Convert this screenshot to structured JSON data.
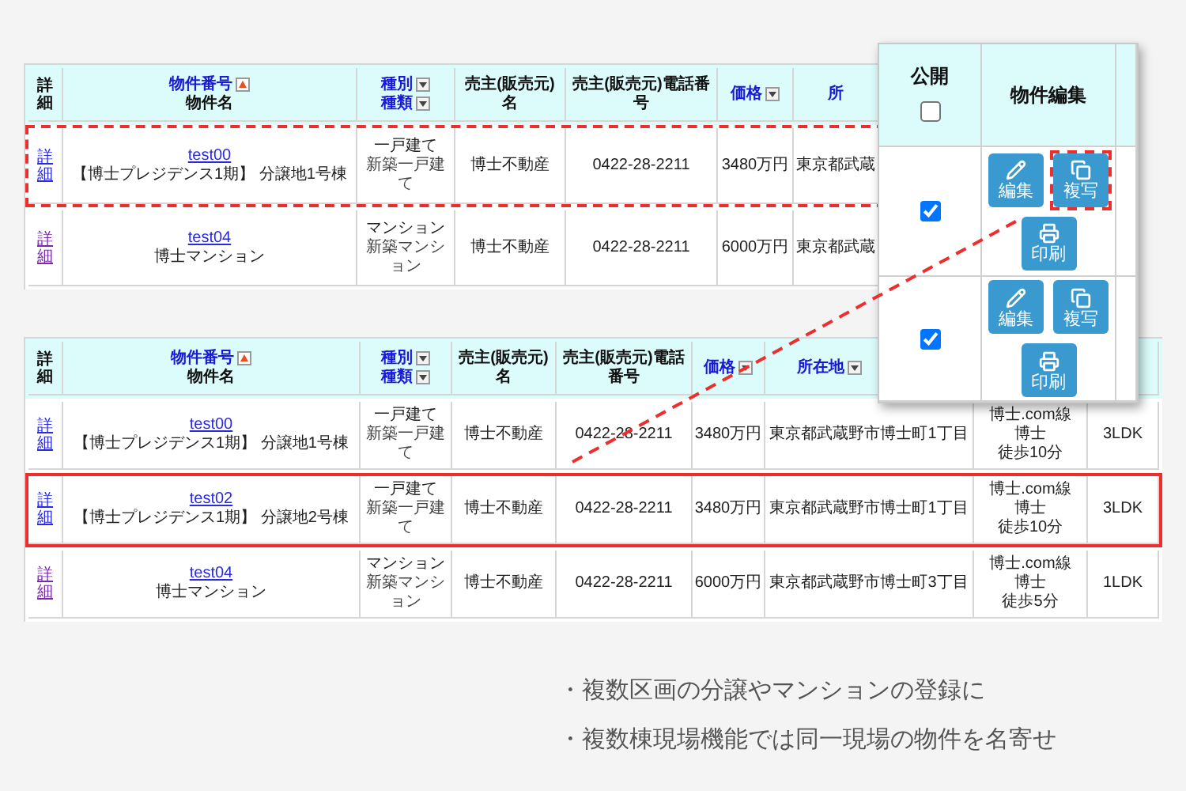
{
  "top_table": {
    "columns": [
      {
        "lines": [
          {
            "text": "詳細",
            "link": false
          }
        ]
      },
      {
        "lines": [
          {
            "text": "物件番号",
            "link": true,
            "sort_asc": true
          },
          {
            "text": "物件名",
            "link": false
          }
        ]
      },
      {
        "lines": [
          {
            "text": "種別",
            "link": true,
            "dropdown": true
          },
          {
            "text": "種類",
            "link": true,
            "dropdown": true
          }
        ]
      },
      {
        "lines": [
          {
            "text": "売主(販売元)名",
            "link": false
          }
        ]
      },
      {
        "lines": [
          {
            "text": "売主(販売元)電話番号",
            "link": false
          }
        ]
      },
      {
        "lines": [
          {
            "text": "価格",
            "link": true,
            "dropdown": true
          }
        ]
      },
      {
        "lines": [
          {
            "text": "所",
            "link": true
          }
        ]
      }
    ],
    "rows": [
      {
        "kind": "dashed",
        "detail": "詳細",
        "visited": false,
        "number": "test00",
        "name": "【博士プレジデンス1期】 分譲地1号棟",
        "type": "一戸建て",
        "subtype": "新築一戸建て",
        "seller": "博士不動産",
        "phone": "0422-28-2211",
        "price": "3480万円",
        "address": "東京都武蔵"
      },
      {
        "kind": "plain",
        "detail": "詳細",
        "visited": true,
        "number": "test04",
        "name": "博士マンション",
        "type": "マンション",
        "subtype": "新築マンション",
        "seller": "博士不動産",
        "phone": "0422-28-2211",
        "price": "6000万円",
        "address": "東京都武蔵"
      }
    ]
  },
  "bottom_table": {
    "columns": [
      {
        "lines": [
          {
            "text": "詳細",
            "link": false
          }
        ]
      },
      {
        "lines": [
          {
            "text": "物件番号",
            "link": true,
            "sort_asc": true
          },
          {
            "text": "物件名",
            "link": false
          }
        ]
      },
      {
        "lines": [
          {
            "text": "種別",
            "link": true,
            "dropdown": true
          },
          {
            "text": "種類",
            "link": true,
            "dropdown": true
          }
        ]
      },
      {
        "lines": [
          {
            "text": "売主(販売元)名",
            "link": false
          }
        ]
      },
      {
        "lines": [
          {
            "text": "売主(販売元)電話番号",
            "link": false
          }
        ]
      },
      {
        "lines": [
          {
            "text": "価格",
            "link": true,
            "dropdown": true
          }
        ]
      },
      {
        "lines": [
          {
            "text": "所在地",
            "link": true,
            "dropdown": true
          }
        ]
      }
    ],
    "rows": [
      {
        "kind": "plain",
        "detail": "詳細",
        "visited": false,
        "number": "test00",
        "name": "【博士プレジデンス1期】 分譲地1号棟",
        "type": "一戸建て",
        "subtype": "新築一戸建て",
        "seller": "博士不動産",
        "phone": "0422-28-2211",
        "price": "3480万円",
        "address": "東京都武蔵野市博士町1丁目",
        "access": [
          "博士.com線",
          "博士",
          "徒歩10分"
        ],
        "layout": "3LDK"
      },
      {
        "kind": "solid",
        "detail": "詳細",
        "visited": false,
        "number": "test02",
        "name": "【博士プレジデンス1期】 分譲地2号棟",
        "type": "一戸建て",
        "subtype": "新築一戸建て",
        "seller": "博士不動産",
        "phone": "0422-28-2211",
        "price": "3480万円",
        "address": "東京都武蔵野市博士町1丁目",
        "access": [
          "博士.com線",
          "博士",
          "徒歩10分"
        ],
        "layout": "3LDK"
      },
      {
        "kind": "plain",
        "detail": "詳細",
        "visited": true,
        "number": "test04",
        "name": "博士マンション",
        "type": "マンション",
        "subtype": "新築マンション",
        "seller": "博士不動産",
        "phone": "0422-28-2211",
        "price": "6000万円",
        "address": "東京都武蔵野市博士町3丁目",
        "access": [
          "博士.com線",
          "博士",
          "徒歩5分"
        ],
        "layout": "1LDK"
      }
    ]
  },
  "popup": {
    "columns": [
      {
        "label": "公開",
        "checkbox": {
          "checked": false
        }
      },
      {
        "label": "物件編集"
      }
    ],
    "rows": [
      {
        "published": true,
        "actions": [
          {
            "kind": "edit",
            "label": "編集",
            "highlight": false
          },
          {
            "kind": "copy",
            "label": "複写",
            "highlight": true
          },
          {
            "kind": "print",
            "label": "印刷",
            "highlight": false
          }
        ]
      },
      {
        "published": true,
        "actions": [
          {
            "kind": "edit",
            "label": "編集",
            "highlight": false
          },
          {
            "kind": "copy",
            "label": "複写",
            "highlight": false
          },
          {
            "kind": "print",
            "label": "印刷",
            "highlight": false
          }
        ]
      }
    ]
  },
  "notes": [
    "・複数区画の分譲やマンションの登録に",
    "・複数棟現場機能では同一現場の物件を名寄せ"
  ]
}
